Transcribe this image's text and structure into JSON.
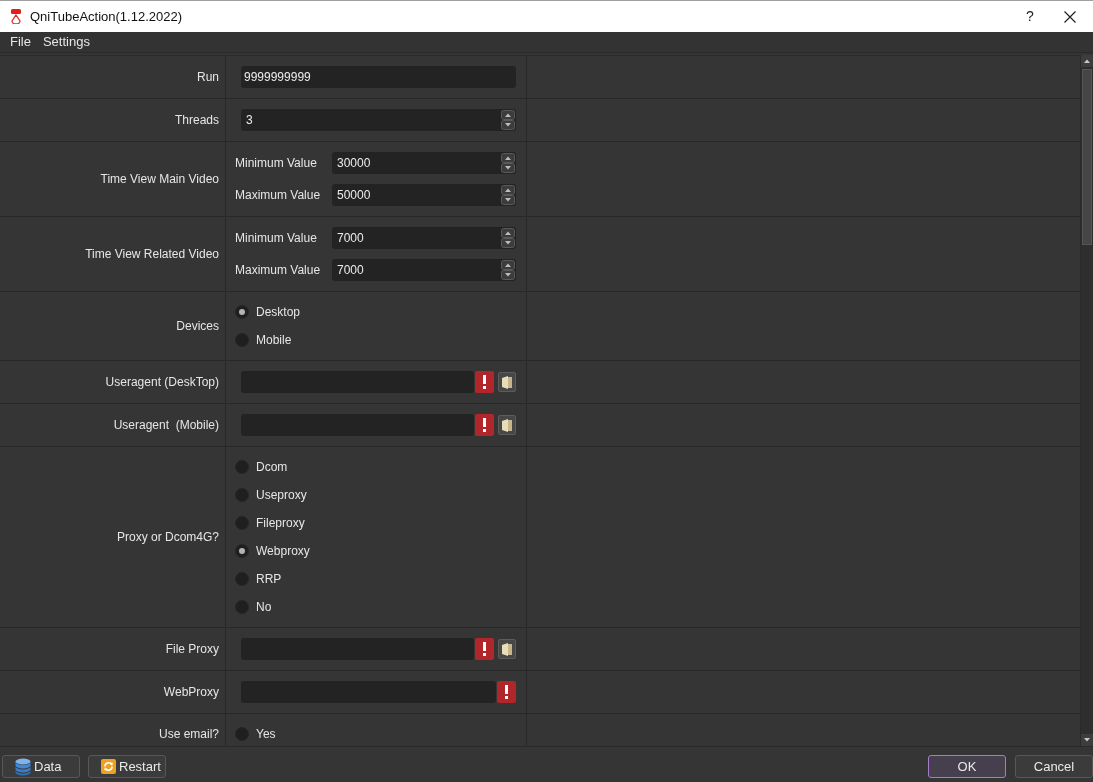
{
  "window": {
    "title": "QniTubeAction(1.12.2022)",
    "help": "?"
  },
  "menu": [
    "File",
    "Settings"
  ],
  "rows": [
    {
      "kind": "text",
      "label": "Run",
      "value": "9999999999"
    },
    {
      "kind": "spin",
      "label": "Threads",
      "value": "3"
    },
    {
      "kind": "range",
      "label": "Time View Main Video",
      "fields": [
        {
          "label": "Minimum Value",
          "value": "30000"
        },
        {
          "label": "Maximum Value",
          "value": "50000"
        }
      ]
    },
    {
      "kind": "range",
      "label": "Time View Related Video",
      "fields": [
        {
          "label": "Minimum Value",
          "value": "7000"
        },
        {
          "label": "Maximum Value",
          "value": "7000"
        }
      ]
    },
    {
      "kind": "radio",
      "label": "Devices",
      "options": [
        {
          "label": "Desktop",
          "selected": true
        },
        {
          "label": "Mobile",
          "selected": false
        }
      ]
    },
    {
      "kind": "file",
      "label": "Useragent (DeskTop)",
      "invalid": true
    },
    {
      "kind": "file",
      "label": "Useragent  (Mobile)",
      "invalid": true
    },
    {
      "kind": "radio",
      "label": "Proxy or Dcom4G?",
      "options": [
        {
          "label": "Dcom",
          "selected": false
        },
        {
          "label": "Useproxy",
          "selected": false
        },
        {
          "label": "Fileproxy",
          "selected": false
        },
        {
          "label": "Webproxy",
          "selected": true
        },
        {
          "label": "RRP",
          "selected": false
        },
        {
          "label": "No",
          "selected": false
        }
      ]
    },
    {
      "kind": "file",
      "label": "File Proxy",
      "invalid": true
    },
    {
      "kind": "text",
      "label": "WebProxy",
      "invalid": true
    },
    {
      "kind": "radio",
      "label": "Use email?",
      "options": [
        {
          "label": "Yes",
          "selected": false
        }
      ]
    }
  ],
  "bottom_bar": {
    "left_buttons": [
      {
        "label": "Data"
      },
      {
        "label": "Restart"
      }
    ],
    "right_buttons": [
      {
        "label": "OK",
        "default": true
      },
      {
        "label": "Cancel",
        "default": false
      }
    ]
  }
}
